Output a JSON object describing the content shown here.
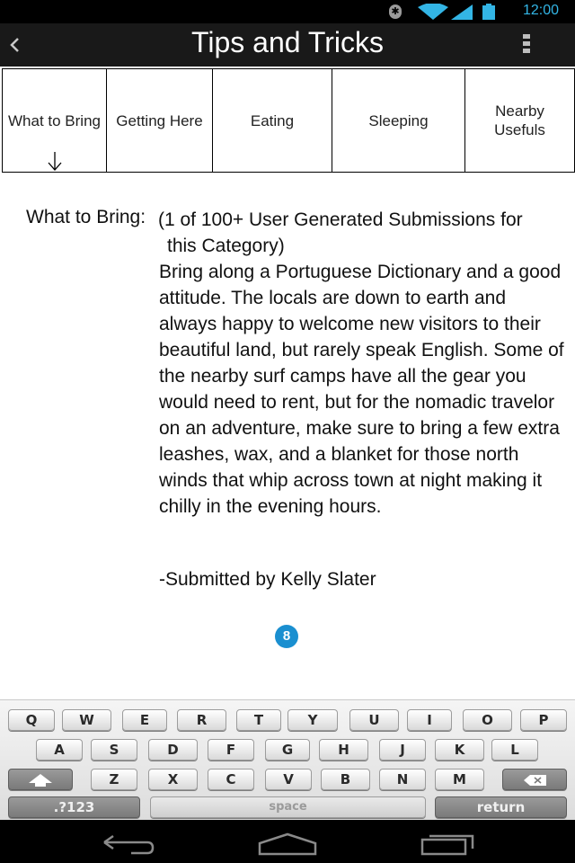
{
  "status_bar": {
    "time": "12:00",
    "icons": [
      "bluetooth-icon",
      "wifi-icon",
      "signal-icon",
      "battery-icon"
    ],
    "accent_color": "#33b5e5"
  },
  "action_bar": {
    "title": "Tips and Tricks",
    "back_icon": "chevron-left-icon",
    "menu_icon": "overflow-menu-icon"
  },
  "tabs": [
    {
      "label": "What to Bring",
      "selected": true
    },
    {
      "label": "Getting Here",
      "selected": false
    },
    {
      "label": "Eating",
      "selected": false
    },
    {
      "label": "Sleeping",
      "selected": false
    },
    {
      "label": "Nearby\nUsefuls",
      "selected": false
    }
  ],
  "content": {
    "label": "What to Bring:",
    "meta_line1": "(1 of 100+ User Generated Submissions for",
    "meta_line2": "this Category)",
    "body": "Bring along a Portuguese Dictionary and a good attitude. The locals are down to earth and always happy to welcome new visitors to their beautiful land, but rarely speak English. Some of the nearby surf camps have all the gear you would need to rent, but for the nomadic travelor on an adventure, make sure to bring a few extra leashes, wax, and a blanket for those north winds that whip across town at night making it chilly in the evening hours.",
    "signature": "-Submitted by Kelly Slater",
    "page_badge": "8",
    "badge_color": "#1a8fd0"
  },
  "keyboard": {
    "row1": [
      "Q",
      "W",
      "E",
      "R",
      "T",
      "Y",
      "U",
      "I",
      "O",
      "P"
    ],
    "row2": [
      "A",
      "S",
      "D",
      "F",
      "G",
      "H",
      "J",
      "K",
      "L"
    ],
    "row3": [
      "Z",
      "X",
      "C",
      "V",
      "B",
      "N",
      "M"
    ],
    "shift_icon": "shift-arrow-icon",
    "backspace_icon": "backspace-icon",
    "symbols_label": ".?123",
    "space_label": "space",
    "return_label": "return"
  },
  "nav_bar": {
    "buttons": [
      "back-arrow-icon",
      "home-icon",
      "recent-apps-icon"
    ]
  }
}
